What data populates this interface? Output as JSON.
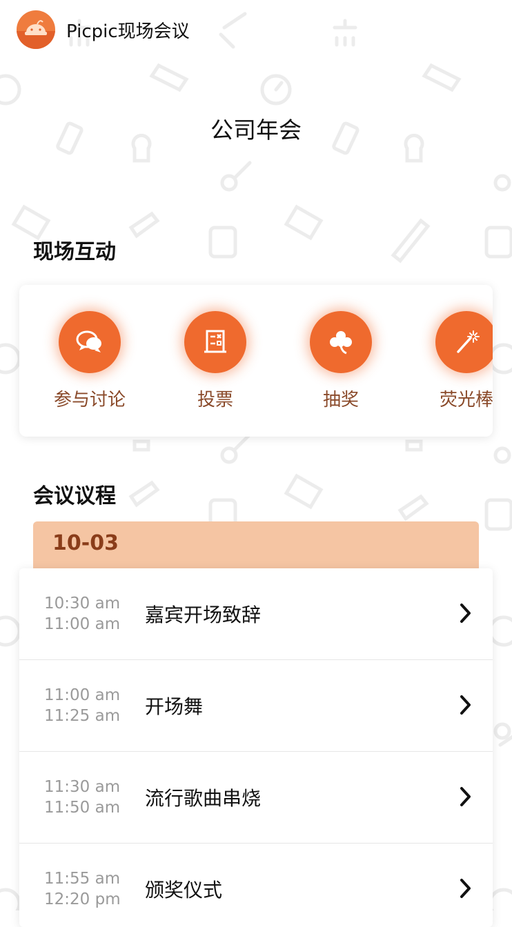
{
  "header": {
    "app_title": "Picpic现场会议",
    "logo_icon": "picpic-logo-icon"
  },
  "page": {
    "title": "公司年会"
  },
  "interact": {
    "section_title": "现场互动",
    "items": [
      {
        "label": "参与讨论",
        "icon": "chat-bubbles-icon"
      },
      {
        "label": "投票",
        "icon": "ballot-board-icon"
      },
      {
        "label": "抽奖",
        "icon": "clover-icon"
      },
      {
        "label": "荧光棒",
        "icon": "magic-wand-icon"
      }
    ]
  },
  "agenda": {
    "section_title": "会议议程",
    "date": "10-03",
    "items": [
      {
        "start": "10:30 am",
        "end": "11:00 am",
        "title": "嘉宾开场致辞"
      },
      {
        "start": "11:00 am",
        "end": "11:25 am",
        "title": "开场舞"
      },
      {
        "start": "11:30 am",
        "end": "11:50 am",
        "title": "流行歌曲串烧"
      },
      {
        "start": "11:55 am",
        "end": "12:20 pm",
        "title": "颁奖仪式"
      }
    ]
  },
  "colors": {
    "accent": "#ef6a2e",
    "date_bar": "#f5c5a3",
    "date_text": "#8a3d1a",
    "label_brown": "#8a4a2a"
  }
}
